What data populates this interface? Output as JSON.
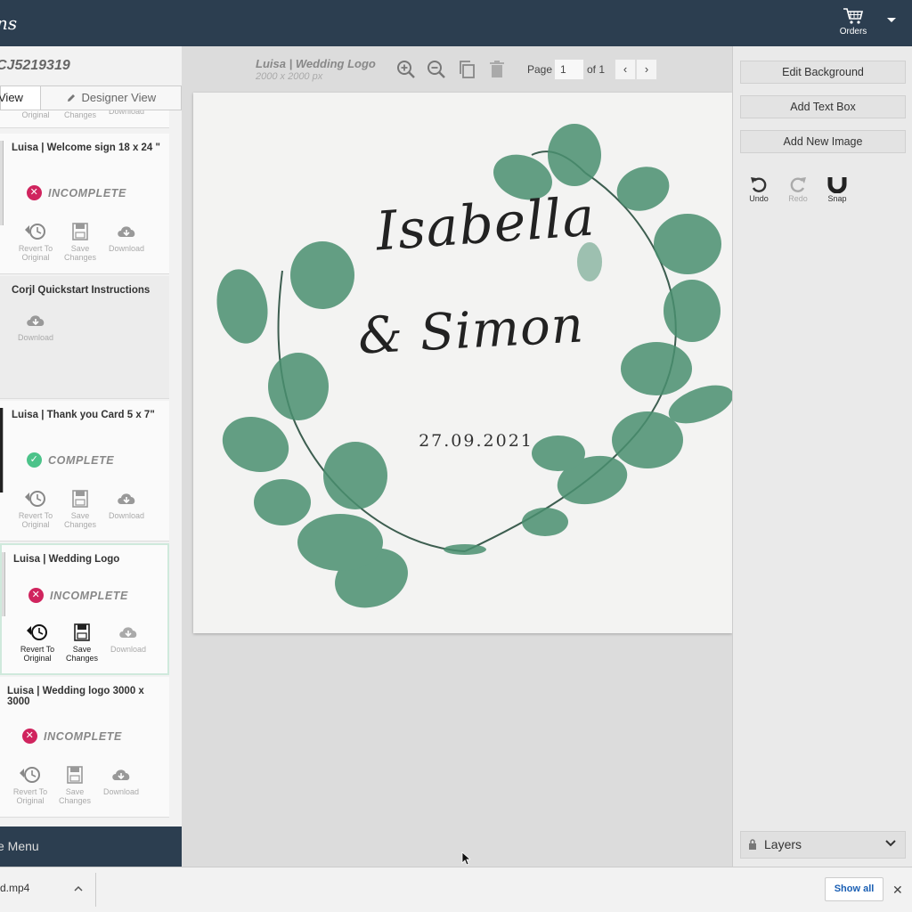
{
  "topbar": {
    "brand": "ns",
    "orders_label": "Orders"
  },
  "sidebar": {
    "order_id": "CJ5219319",
    "tabs": {
      "customer": "View",
      "designer": "Designer View"
    },
    "actions": {
      "revert": "Revert To Original",
      "save": "Save Changes",
      "download": "Download"
    },
    "templates": [
      {
        "title": "Luisa | Welcome sign 18 x 24 \"",
        "status": "INCOMPLETE"
      },
      {
        "title": "Corjl Quickstart Instructions",
        "status": ""
      },
      {
        "title": "Luisa | Thank you Card 5 x 7\"",
        "status": "COMPLETE"
      },
      {
        "title": "Luisa | Wedding Logo",
        "status": "INCOMPLETE"
      },
      {
        "title": "Luisa | Wedding logo 3000 x 3000",
        "status": "INCOMPLETE"
      }
    ],
    "resume_menu": "e Menu"
  },
  "canvas": {
    "doc_title": "Luisa | Wedding Logo",
    "doc_size": "2000 x 2000 px",
    "page_label": "Page",
    "page_value": "1",
    "page_of": "of 1",
    "design": {
      "name1": "Isabella",
      "name2": "& Simon",
      "date": "27.09.2021"
    }
  },
  "right_panel": {
    "edit_background": "Edit Background",
    "add_text_box": "Add Text Box",
    "add_new_image": "Add New Image",
    "undo": "Undo",
    "redo": "Redo",
    "snap": "Snap",
    "layers": "Layers"
  },
  "download_bar": {
    "file": "d.mp4",
    "show_all": "Show all"
  },
  "colors": {
    "header": "#2c3e50",
    "incomplete": "#d0245e",
    "complete": "#4cc38a",
    "leaf": "#4a8f70"
  }
}
